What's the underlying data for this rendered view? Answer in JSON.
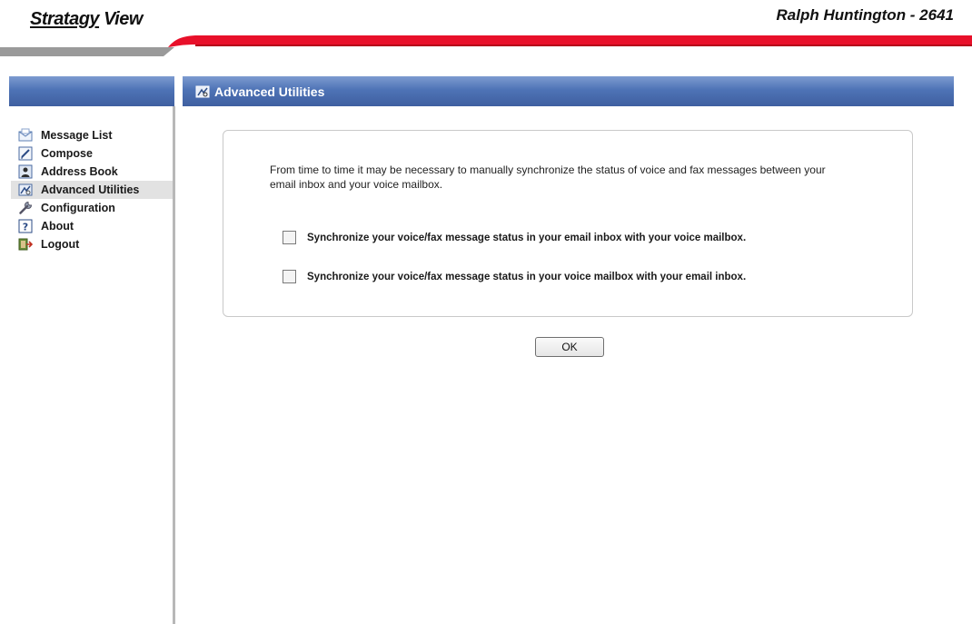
{
  "header": {
    "logo_brand": "Stratagy",
    "logo_suffix": " View",
    "user": "Ralph Huntington - 2641"
  },
  "sidebar": {
    "items": [
      {
        "label": "Message List",
        "icon": "envelope-icon",
        "active": false
      },
      {
        "label": "Compose",
        "icon": "compose-icon",
        "active": false
      },
      {
        "label": "Address Book",
        "icon": "address-book-icon",
        "active": false
      },
      {
        "label": "Advanced Utilities",
        "icon": "utilities-icon",
        "active": true
      },
      {
        "label": "Configuration",
        "icon": "wrench-icon",
        "active": false
      },
      {
        "label": "About",
        "icon": "help-icon",
        "active": false
      },
      {
        "label": "Logout",
        "icon": "logout-icon",
        "active": false
      }
    ]
  },
  "main": {
    "title": "Advanced Utilities",
    "title_icon": "utilities-icon",
    "description": "From time to time it may be necessary to manually synchronize the status of voice and fax messages between your email inbox and your voice mailbox.",
    "options": [
      {
        "label": "Synchronize your voice/fax message status in your email inbox with your voice mailbox.",
        "checked": false
      },
      {
        "label": "Synchronize your voice/fax message status in your voice mailbox with your email inbox.",
        "checked": false
      }
    ],
    "ok_label": "OK"
  },
  "colors": {
    "accent_red": "#e8102a",
    "header_blue": "#4e73b6",
    "swoosh_gray": "#9a9a9a"
  }
}
